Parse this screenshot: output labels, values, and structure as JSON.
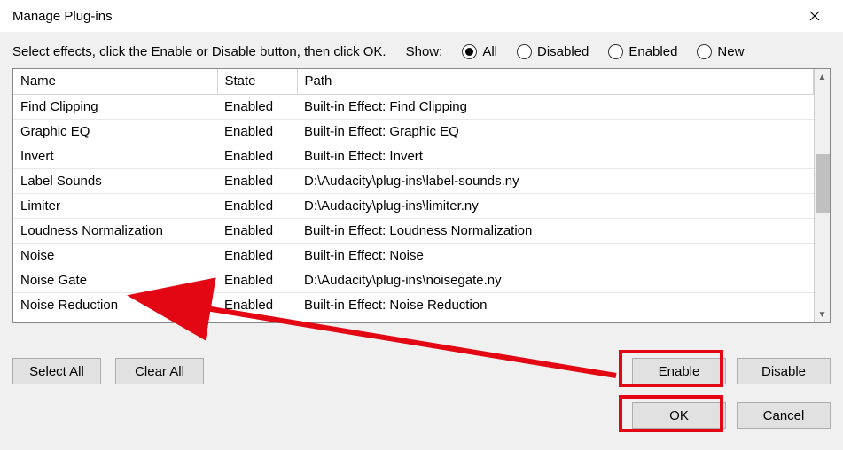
{
  "title": "Manage Plug-ins",
  "instruction": "Select effects, click the Enable or Disable button, then click OK.",
  "show_label": "Show:",
  "filters": {
    "all": "All",
    "disabled": "Disabled",
    "enabled": "Enabled",
    "new": "New",
    "selected": "all"
  },
  "columns": {
    "name": "Name",
    "state": "State",
    "path": "Path"
  },
  "rows": [
    {
      "name": "Find Clipping",
      "state": "Enabled",
      "path": "Built-in Effect: Find Clipping"
    },
    {
      "name": "Graphic EQ",
      "state": "Enabled",
      "path": "Built-in Effect: Graphic EQ"
    },
    {
      "name": "Invert",
      "state": "Enabled",
      "path": "Built-in Effect: Invert"
    },
    {
      "name": "Label Sounds",
      "state": "Enabled",
      "path": "D:\\Audacity\\plug-ins\\label-sounds.ny"
    },
    {
      "name": "Limiter",
      "state": "Enabled",
      "path": "D:\\Audacity\\plug-ins\\limiter.ny"
    },
    {
      "name": "Loudness Normalization",
      "state": "Enabled",
      "path": "Built-in Effect: Loudness Normalization"
    },
    {
      "name": "Noise",
      "state": "Enabled",
      "path": "Built-in Effect: Noise"
    },
    {
      "name": "Noise Gate",
      "state": "Enabled",
      "path": "D:\\Audacity\\plug-ins\\noisegate.ny"
    },
    {
      "name": "Noise Reduction",
      "state": "Enabled",
      "path": "Built-in Effect: Noise Reduction"
    }
  ],
  "buttons": {
    "select_all": "Select All",
    "clear_all": "Clear All",
    "enable": "Enable",
    "disable": "Disable",
    "ok": "OK",
    "cancel": "Cancel"
  },
  "annotation": {
    "arrow_target_row": "Noise Gate",
    "highlighted_buttons": [
      "Enable",
      "OK"
    ]
  }
}
